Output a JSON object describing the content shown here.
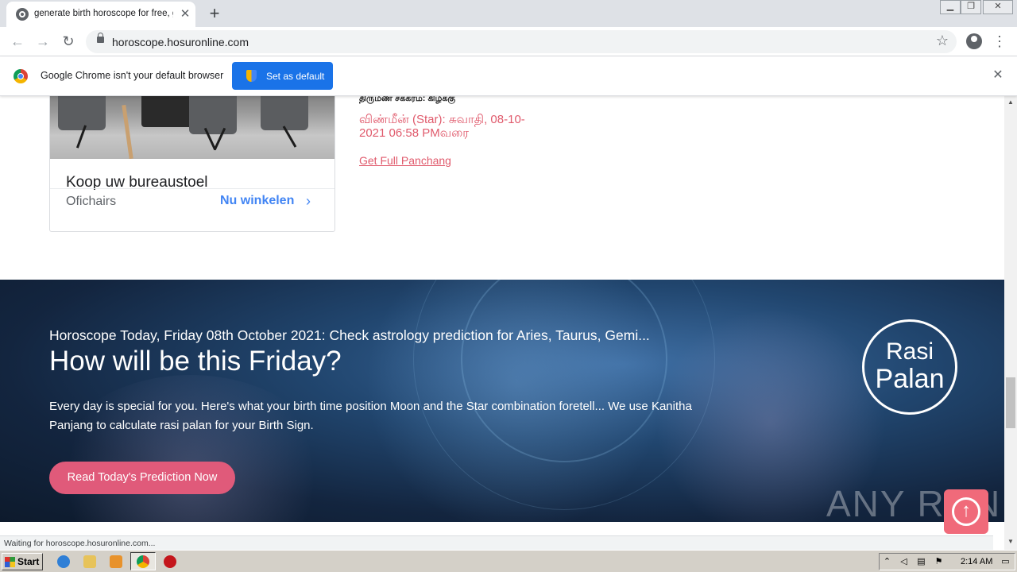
{
  "browser": {
    "tab_title": "generate birth horoscope for free, get",
    "tab_close_glyph": "✕",
    "new_tab_glyph": "+",
    "url": "horoscope.hosuronline.com",
    "infobar_text": "Google Chrome isn't your default browser",
    "set_default_label": "Set as default",
    "status_text": "Waiting for horoscope.hosuronline.com..."
  },
  "ad": {
    "title": "Koop uw bureaustoel",
    "brand": "Ofichairs",
    "cta": "Nu winkelen"
  },
  "panchang": {
    "label": "திருமண சக்கரம்: கிழக்கு",
    "star_line": "விண்மீன் (Star): சுவாதி, 08-10-2021 06:58 PMவரை",
    "link": "Get Full Panchang"
  },
  "hero": {
    "subtitle": "Horoscope Today, Friday 08th October 2021: Check astrology prediction for Aries, Taurus, Gemi...",
    "title": "How will be this Friday?",
    "body": "Every day is special for you. Here's what your birth time position Moon and the Star combination foretell... We use Kanitha Panjang to calculate rasi palan for your Birth Sign.",
    "button": "Read Today's Prediction Now",
    "badge_line1": "Rasi",
    "badge_line2": "Palan",
    "watermark": "ANY RUN"
  },
  "taskbar": {
    "start_label": "Start",
    "clock": "2:14 AM"
  },
  "colors": {
    "accent_pink": "#e05a6c",
    "chrome_blue": "#1a73e8",
    "hero_dark": "#13253f"
  },
  "icons": [
    "globe-icon",
    "close-icon",
    "plus-icon",
    "back-icon",
    "forward-icon",
    "reload-icon",
    "lock-icon",
    "star-icon",
    "account-icon",
    "menu-icon",
    "chrome-logo-icon",
    "shield-icon",
    "chevron-right-icon",
    "arrow-up-icon"
  ]
}
